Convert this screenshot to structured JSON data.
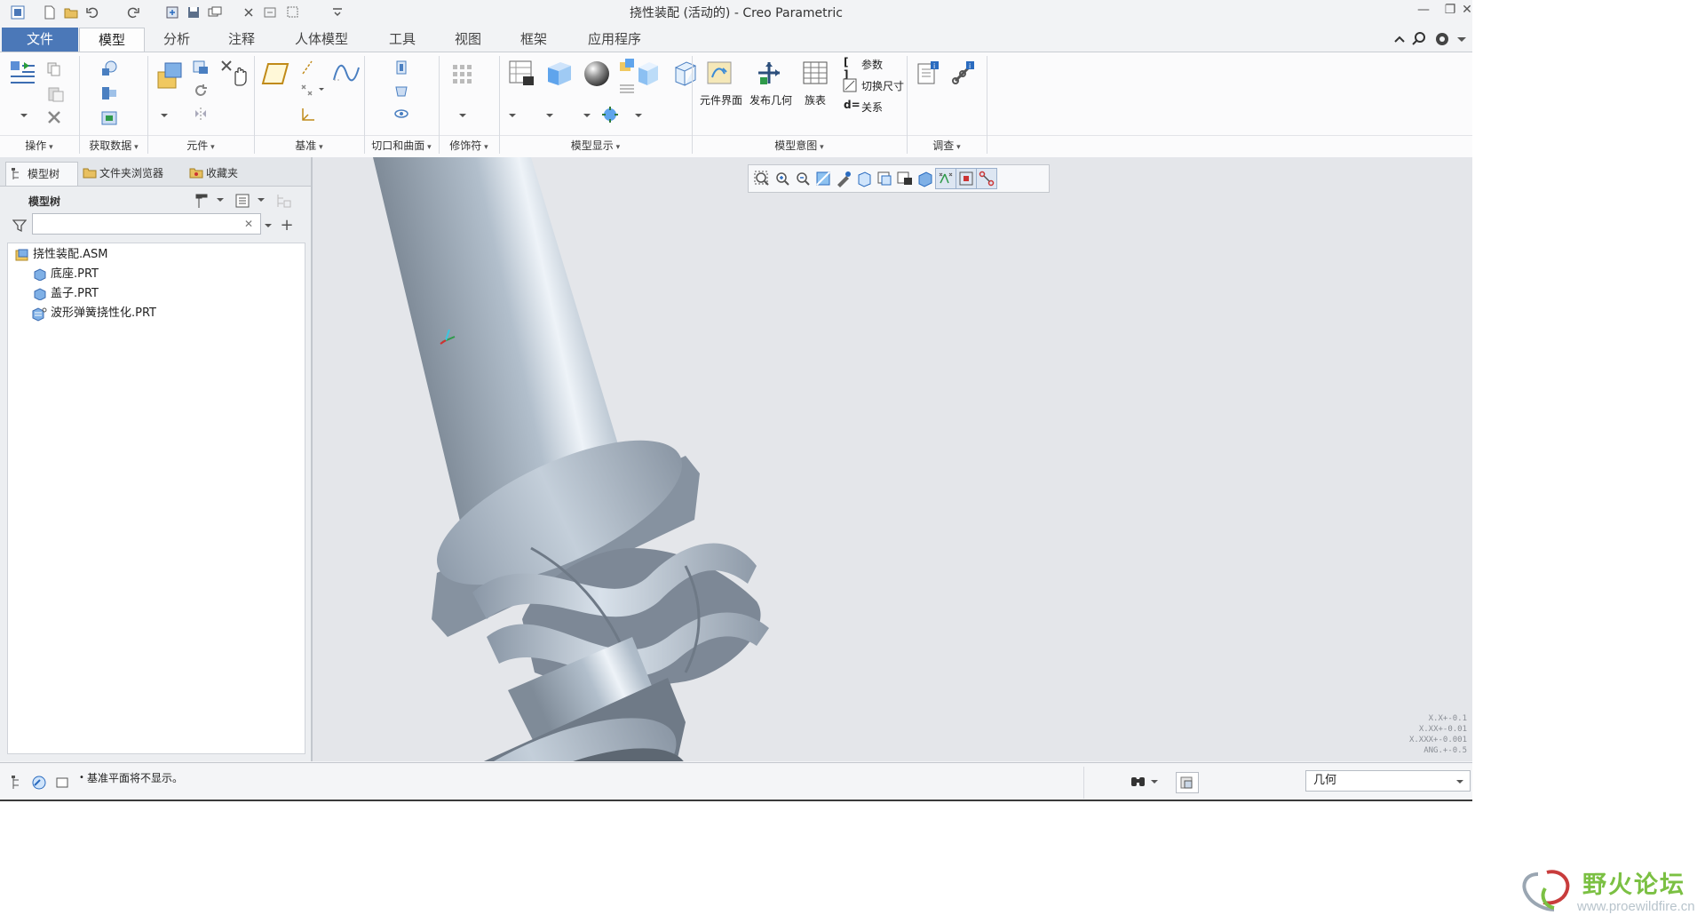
{
  "window": {
    "title": "挠性装配 (活动的) - Creo Parametric",
    "min_label": "—",
    "max_label": "❐",
    "close_label": "✕"
  },
  "ribbon_tabs": [
    "文件",
    "模型",
    "分析",
    "注释",
    "人体模型",
    "工具",
    "视图",
    "框架",
    "应用程序"
  ],
  "active_tab": "模型",
  "ribbon_groups": {
    "operations": "操作",
    "get_data": "获取数据",
    "component": "元件",
    "datum": "基准",
    "cut_surface": "切口和曲面",
    "modifiers": "修饰符",
    "model_display": "模型显示",
    "model_intent": "模型意图",
    "investigate": "调查"
  },
  "ribbon_buttons": {
    "component_interface": "元件界面",
    "publish_geometry": "发布几何",
    "family_table": "族表",
    "parameters": "参数",
    "switch_dimensions": "切换尺寸",
    "relations": "关系"
  },
  "panel": {
    "tabs": [
      "模型树",
      "文件夹浏览器",
      "收藏夹"
    ],
    "tree_label": "模型树",
    "search_value": "",
    "clear_label": "✕",
    "tree": [
      {
        "label": "挠性装配.ASM",
        "level": 0,
        "type": "assembly"
      },
      {
        "label": "底座.PRT",
        "level": 1,
        "type": "part"
      },
      {
        "label": "盖子.PRT",
        "level": 1,
        "type": "part"
      },
      {
        "label": "波形弹簧挠性化.PRT",
        "level": 1,
        "type": "flex-part"
      }
    ]
  },
  "tolerance": [
    "X.X+-0.1",
    "X.XX+-0.01",
    "X.XXX+-0.001",
    "ANG.+-0.5"
  ],
  "status": {
    "message": "基准平面将不显示。",
    "filter_value": "几何"
  },
  "watermark": {
    "name": "野火论坛",
    "url": "www.proewildfire.cn"
  },
  "colors": {
    "file_tab": "#4b78b8",
    "model_body": "#a9b6c4",
    "viewport_bg": "#e4e6ea",
    "watermark_green": "#7bc043"
  }
}
